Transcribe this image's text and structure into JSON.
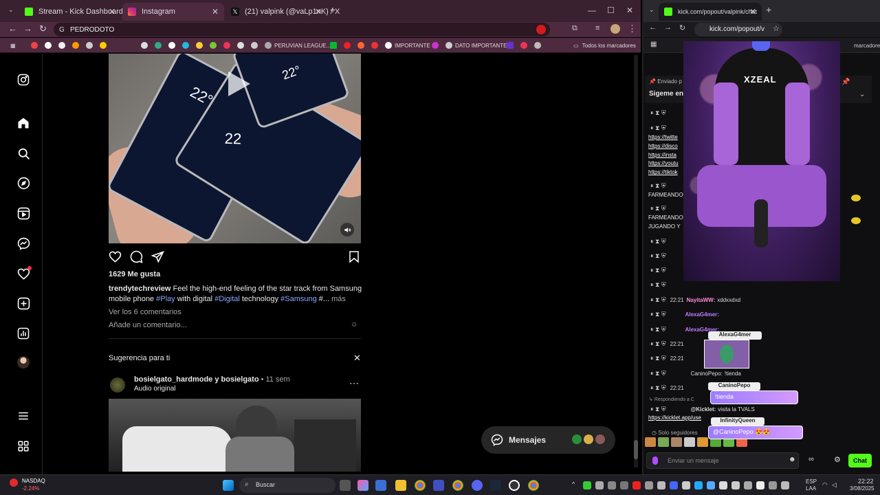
{
  "left_browser": {
    "tabs": [
      {
        "label": "Stream - Kick Dashboard",
        "color": "#53fc18"
      },
      {
        "label": "Instagram",
        "color": "#e1306c"
      },
      {
        "label": "(21) valpink (@vaLp1nK) / X",
        "color": "#ffffff"
      }
    ],
    "address": "PEDRODOTO",
    "bookmarks": [
      {
        "label": "PERUVIAN LEAGUE..."
      },
      {
        "label": "IMPORTANTE"
      },
      {
        "label": "DATO IMPORTANTE"
      },
      {
        "label": "Todos los marcadores"
      }
    ]
  },
  "instagram": {
    "likes": "1629 Me gusta",
    "caption_user": "trendytechreview",
    "caption_text_1": " Feel the high-end feeling of the star track from Samsung mobile phone ",
    "tag_play": "#Play",
    "caption_text_2": " with digital ",
    "tag_digital": "#Digital",
    "caption_text_3": " technology ",
    "tag_samsung": "#Samsung",
    "caption_text_4": " #...",
    "more": " más",
    "view_comments": "Ver los 6 comentarios",
    "add_comment_placeholder": "Añade un comentario...",
    "suggestion_title": "Sugerencia para ti",
    "post2_users": "bosielgato_hardmode y bosielgato",
    "post2_time": " • 11 sem",
    "post2_audio": "Audio original",
    "messages_label": "Mensajes",
    "phone_temp_1": "22°",
    "phone_temp_2": "22",
    "phone_temp_3": "22°"
  },
  "right_browser": {
    "tab_label": "kick.com/popout/valpink/chat",
    "address": "kick.com/popout/v",
    "bookmarks_label": "marcadores",
    "pinned": "Enviado p",
    "pinned_title": "Sigeme en",
    "links": [
      "https://twitte",
      "https://disco",
      "https://insta",
      "https://youtu",
      "https://tiktok"
    ],
    "farm1": "FARMEANDO",
    "farm2": "FARMEANDO",
    "farm3": "JUGANDO Y",
    "chat": [
      {
        "time": "22:21",
        "user": "NayitaWW:",
        "msg": "xddxxdxd",
        "color": "#ff8ad8"
      },
      {
        "time": "",
        "user": "AlexaG4mer:",
        "msg": "",
        "color": "#c07bff"
      },
      {
        "time": "",
        "user": "AlexaG4mer:",
        "msg": "",
        "color": "#c07bff"
      },
      {
        "time": "22:21",
        "user": "",
        "msg": "",
        "color": "#ccc"
      },
      {
        "time": "22:21",
        "user": "CaninoPepo:",
        "msg": "!tienda",
        "color": "#ccc"
      },
      {
        "time": "22:21",
        "user": "",
        "msg": "",
        "color": "#ccc"
      }
    ],
    "replying": "Respondiendo a C",
    "kicklet_user": "@Kicklet:",
    "kicklet_msg": "visita la TVALS",
    "kicklet_link": "https://kicklet.app/use",
    "followers_only": "Solo seguidores",
    "send_placeholder": "Enviar un mensaje",
    "chat_button": "Chat",
    "cam_brand": "XZEAL",
    "overlay_alexa": "AlexaG4mer",
    "overlay_canino": "CaninoPepo",
    "overlay_canino_msg": "!tienda",
    "overlay_infinity": "InfinityQueen",
    "overlay_infinity_msg": "@CaninoPepo 😍😍"
  },
  "taskbar": {
    "stock_name": "NASDAQ",
    "stock_change": "-2.24%",
    "search_label": "Buscar",
    "lang": "ESP",
    "lang2": "LAA",
    "time": "22:22",
    "date": "3/08/2025"
  },
  "colors": {
    "kick_green": "#53fc18",
    "browser_tab_bg": "#3a2130",
    "ig_tag": "#8ba8ff"
  }
}
